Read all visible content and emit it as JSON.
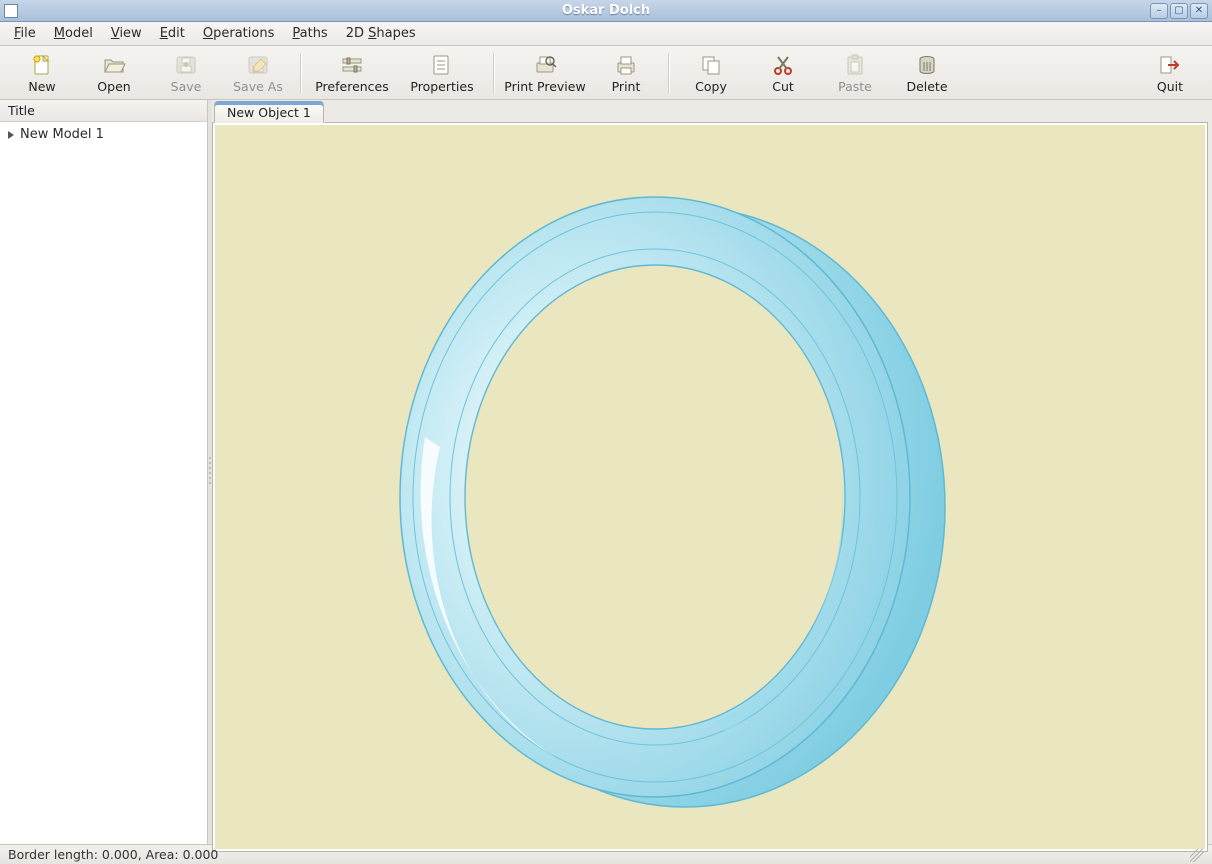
{
  "window": {
    "title": "Oskar Dolch"
  },
  "menus": {
    "file": "File",
    "model": "Model",
    "view": "View",
    "edit": "Edit",
    "operations": "Operations",
    "paths": "Paths",
    "shapes2d": "2D Shapes"
  },
  "toolbar": {
    "new": "New",
    "open": "Open",
    "save": "Save",
    "saveas": "Save As",
    "preferences": "Preferences",
    "properties": "Properties",
    "printpreview": "Print Preview",
    "print": "Print",
    "copy": "Copy",
    "cut": "Cut",
    "paste": "Paste",
    "delete": "Delete",
    "quit": "Quit"
  },
  "sidebar": {
    "header": "Title",
    "items": [
      {
        "label": "New Model 1"
      }
    ]
  },
  "tabs": [
    {
      "label": "New Object 1",
      "active": true
    }
  ],
  "status": {
    "text": "Border length: 0.000, Area: 0.000"
  },
  "colors": {
    "canvas_bg": "#e9e6c0",
    "ring_fill": "#a7dceb",
    "ring_stroke": "#5fb9d3"
  }
}
